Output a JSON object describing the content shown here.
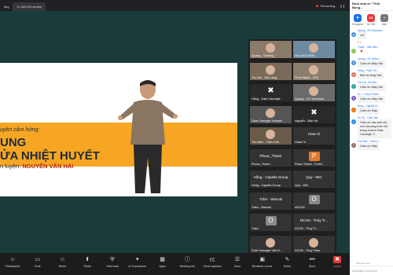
{
  "browser": {
    "tabs": [
      {
        "label": "ting"
      },
      {
        "label": "Cr  sDCVN screen"
      }
    ],
    "recording": "Recording..."
  },
  "slide": {
    "line1": "uyền cảm hứng:",
    "line2": "UNG",
    "line3": "ỬA NHIỆT HUYẾT",
    "line4_prefix": "n luyện:",
    "line4_name": "NGUYỄN VĂN HẢI"
  },
  "participants": [
    {
      "name": "Quang - Thường",
      "col": 0,
      "row": 0,
      "bg": "#8a7a6a"
    },
    {
      "name": "Hải (NGUYỄN)",
      "col": 1,
      "row": 0,
      "bg": "#6d8aa0"
    },
    {
      "name": "Thu Hà - Văn Lang",
      "col": 0,
      "row": 1,
      "bg": "#7a6a5a"
    },
    {
      "name": "Phan Mạnh - VFS",
      "col": 1,
      "row": 1,
      "bg": "#8b7d6b"
    },
    {
      "name": "Hằng - Dale Carnegie",
      "col": 0,
      "row": 2,
      "bg": "#2a2a2a",
      "logo": true
    },
    {
      "name": "Quang - SV Techmore",
      "col": 1,
      "row": 2,
      "bg": "#6a6a6a"
    },
    {
      "name": "Dale Carnegie Vietnam",
      "col": 0,
      "row": 3,
      "bg": "#555"
    },
    {
      "name": "Nguyễn - Bảo Hà",
      "col": 1,
      "row": 3,
      "bg": "#2a2a2a",
      "logo": true
    },
    {
      "name": "Thu Hiền - Trâm Anh",
      "col": 0,
      "row": 4,
      "bg": "#6a5a4a"
    },
    {
      "name": "Hoan Hi",
      "col": 1,
      "row": 4,
      "bg": "#333",
      "big": "Hoan hi"
    },
    {
      "name": "Phuoc_Thanh",
      "col": 0,
      "row": 5,
      "bg": "#333",
      "big": "Phuoc_Thanh"
    },
    {
      "name": "Phạm Thành - Fresh...",
      "col": 1,
      "row": 5,
      "bg": "#333",
      "avatar": "P",
      "avatar_bg": "#e07a2e"
    },
    {
      "name": "Hồng - Capella Group",
      "col": 0,
      "row": 6,
      "bg": "#333",
      "big": "Hồng - Capella Group"
    },
    {
      "name": "Quý - MIC",
      "col": 1,
      "row": 6,
      "bg": "#333",
      "big": "Quý - MIC"
    },
    {
      "name": "Trâm - Wacoal",
      "col": 0,
      "row": 7,
      "bg": "#333",
      "big": "Trâm - Wacoal"
    },
    {
      "name": "sDCVN",
      "col": 1,
      "row": 7,
      "bg": "#333",
      "avatar": "O",
      "avatar_bg": "#8a8a8a"
    },
    {
      "name": "Trâm",
      "col": 0,
      "row": 8,
      "bg": "#333",
      "avatar": "O",
      "avatar_bg": "#8a8a8a"
    },
    {
      "name": "DCVN - Thùy Tr...",
      "col": 1,
      "row": 8,
      "bg": "#333",
      "big": "DCVN - Thùy Tr..."
    },
    {
      "name": "Dale Carnegie Việt N...",
      "col": 0,
      "row": 9,
      "bg": "#333"
    },
    {
      "name": "DCVN - Thùy Trâm",
      "col": 1,
      "row": 9,
      "bg": "#333"
    }
  ],
  "toolbar": [
    {
      "label": "Participants",
      "icon": "participants-icon"
    },
    {
      "label": "Chat",
      "icon": "chat-icon"
    },
    {
      "label": "React",
      "icon": "react-icon"
    },
    {
      "label": "Share",
      "icon": "share-icon"
    },
    {
      "label": "Host tools",
      "icon": "shield-icon"
    },
    {
      "label": "AI Companion",
      "icon": "ai-icon"
    },
    {
      "label": "Apps",
      "icon": "apps-icon"
    },
    {
      "label": "Meeting info",
      "icon": "info-icon"
    },
    {
      "label": "Show captions",
      "icon": "captions-icon"
    },
    {
      "label": "Docs",
      "icon": "docs-icon"
    },
    {
      "label": "Breakout rooms",
      "icon": "breakout-icon"
    },
    {
      "label": "Notes",
      "icon": "notes-icon"
    },
    {
      "label": "More",
      "icon": "more-icon"
    },
    {
      "label": "Leave",
      "icon": "leave-icon"
    }
  ],
  "chat": {
    "title": "Buổi chia sẻ \"Thổi Bùng...",
    "tabs": [
      {
        "label": "Everyone",
        "abbr": "⚑",
        "color": "#1a73e8"
      },
      {
        "label": "DC VN",
        "abbr": "ZO",
        "color": "#e53935"
      },
      {
        "label": "Nev",
        "abbr": "+",
        "color": "#777"
      }
    ],
    "messages": [
      {
        "sender": "Quang - SV Techmore",
        "text": "4.6",
        "avatar": "Q",
        "color": "#4a90d9"
      },
      {
        "sender": "",
        "text": "♥ 1",
        "avatar": "",
        "color": "#fff",
        "react": true
      },
      {
        "sender": "Thành - Viện Đầu...",
        "text": "♥",
        "avatar": "T",
        "color": "#8bc34a",
        "heart": true
      },
      {
        "sender": "Quang - SV Techm...",
        "text": "Cảm ơn thầy Hải",
        "avatar": "Q",
        "color": "#4a90d9"
      },
      {
        "sender": "Hằng - PHAT VN...",
        "text": "Biết ơn thầy Hải",
        "avatar": "H",
        "color": "#d87a5a"
      },
      {
        "sender": "Thu Hà - Mô-Bim...",
        "text": "Cảm ơn thầy Hải",
        "avatar": "T",
        "color": "#26a69a"
      },
      {
        "sender": "So - Y khoa Thánh...",
        "text": "Cảm ơn thầy Hải",
        "avatar": "S",
        "color": "#7e57c2"
      },
      {
        "sender": "Hồng - Capella Gr...",
        "text": "Cảm ơn thầy",
        "avatar": "H",
        "color": "#ef6c00"
      },
      {
        "sender": "DCVN - Thái Trâm",
        "text": "Cảm ơn các anh chị ven chương trình chị trong chươn Dale Carnegie V",
        "avatar": "D",
        "color": "#1e88e5"
      },
      {
        "sender": "Thu Hiền - Trâm A...",
        "text": "Cảm ơn thầy",
        "avatar": "T",
        "color": "#8d6e63"
      }
    ],
    "who_can_see": "Who can see",
    "input_placeholder": "Message everyone"
  }
}
